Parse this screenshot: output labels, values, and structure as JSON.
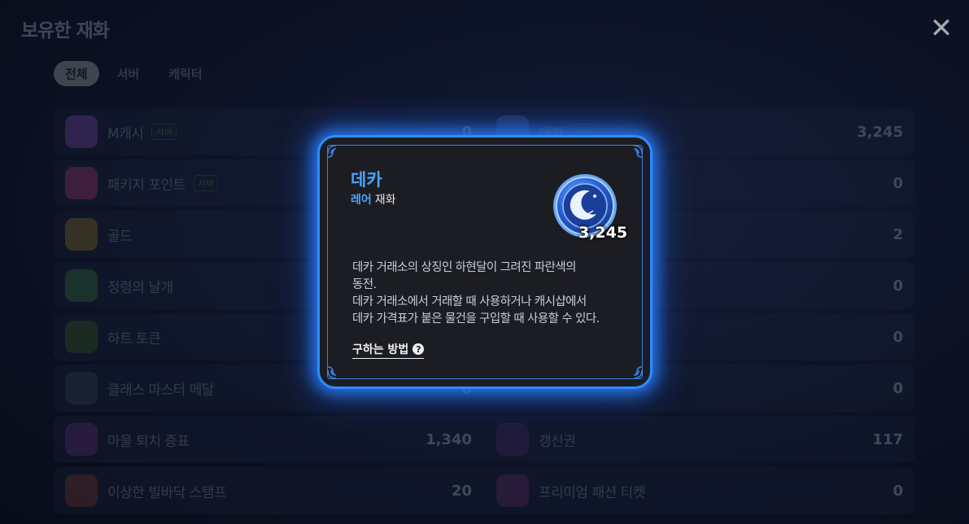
{
  "header": {
    "title": "보유한 재화",
    "close_icon": "✕"
  },
  "tabs": [
    {
      "label": "전체",
      "active": true
    },
    {
      "label": "서버",
      "active": false
    },
    {
      "label": "캐릭터",
      "active": false
    }
  ],
  "currencies": [
    {
      "left": {
        "name": "M캐시",
        "badge": "서버",
        "value": "0",
        "icon": "m-cash-icon",
        "color": "#5a3d8a"
      },
      "right": {
        "name": "데카",
        "badge": "서버",
        "value": "3,245",
        "icon": "deka-coin-icon",
        "color": "#34509a"
      }
    },
    {
      "left": {
        "name": "패키지 포인트",
        "badge": "서버",
        "value": "",
        "icon": "package-point-icon",
        "color": "#7a2f63"
      },
      "right": {
        "name": "",
        "badge": "",
        "value": "0",
        "icon": "",
        "color": ""
      }
    },
    {
      "left": {
        "name": "골드",
        "badge": "",
        "value": "",
        "icon": "gold-coin-icon",
        "color": "#6a5a2e"
      },
      "right": {
        "name": "",
        "badge": "",
        "value": "2",
        "icon": "",
        "color": ""
      }
    },
    {
      "left": {
        "name": "정령의 날개",
        "badge": "",
        "value": "",
        "icon": "spirit-wing-icon",
        "color": "#2f5a3a"
      },
      "right": {
        "name": "",
        "badge": "",
        "value": "0",
        "icon": "",
        "color": ""
      }
    },
    {
      "left": {
        "name": "하트 토큰",
        "badge": "",
        "value": "",
        "icon": "heart-token-icon",
        "color": "#2f4a2a"
      },
      "right": {
        "name": "",
        "badge": "",
        "value": "0",
        "icon": "",
        "color": ""
      }
    },
    {
      "left": {
        "name": "클래스 마스터 메달",
        "badge": "",
        "value": "0",
        "icon": "class-master-medal-icon",
        "color": "#2a3a4a"
      },
      "right": {
        "name": "",
        "badge": "",
        "value": "0",
        "icon": "",
        "color": "#2a3e7a"
      }
    },
    {
      "left": {
        "name": "마물 퇴치 증표",
        "badge": "",
        "value": "1,340",
        "icon": "monster-token-icon",
        "color": "#4a2c6a"
      },
      "right": {
        "name": "갱신권",
        "badge": "",
        "value": "117",
        "icon": "renewal-ticket-icon",
        "color": "#3a2a5a"
      }
    },
    {
      "left": {
        "name": "이상한 빌바닥 스탬프",
        "badge": "",
        "value": "20",
        "icon": "stamp-icon",
        "color": "#5a3030"
      },
      "right": {
        "name": "프리미엄 패션 티켓",
        "badge": "",
        "value": "0",
        "icon": "premium-ticket-icon",
        "color": "#4a2a5a"
      }
    }
  ],
  "popup": {
    "title": "데카",
    "rarity": "레어",
    "type": "재화",
    "amount": "3,245",
    "description": [
      "데카 거래소의 상징인 하현달이 그려진 파란색의",
      "동전.",
      "데카 거래소에서 거래할 때 사용하거나 캐시샵에서",
      "데카 가격표가 붙은 물건을 구입할 때 사용할 수 있다."
    ],
    "how_to_get": "구하는 방법",
    "accent_color": "#4ba2ff"
  }
}
